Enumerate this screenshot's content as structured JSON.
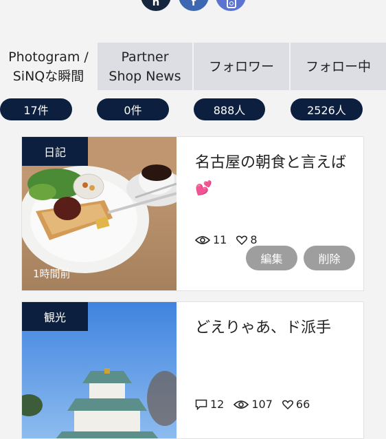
{
  "social": {
    "note_label": "n",
    "fb_label": "f"
  },
  "tabs": [
    {
      "label": "Photogram /\nSiNQな瞬間",
      "active": true
    },
    {
      "label": "Partner\nShop News",
      "active": false
    },
    {
      "label": "フォロワー",
      "active": false
    },
    {
      "label": "フォロー中",
      "active": false
    }
  ],
  "counts": [
    "17件",
    "0件",
    "888人",
    "2526人"
  ],
  "posts": [
    {
      "category": "日記",
      "title": "名古屋の朝食と言えば",
      "time": "1時間前",
      "views": "11",
      "likes": "8",
      "edit_label": "編集",
      "delete_label": "削除"
    },
    {
      "category": "観光",
      "title": "どえりゃあ、ド派手",
      "comments": "12",
      "views": "107",
      "likes": "66"
    }
  ],
  "colors": {
    "navy": "#0d1f3e",
    "tab_bg": "#dcdee4",
    "page_bg": "#f3f3f4",
    "button_gray": "#9e9e9e"
  }
}
